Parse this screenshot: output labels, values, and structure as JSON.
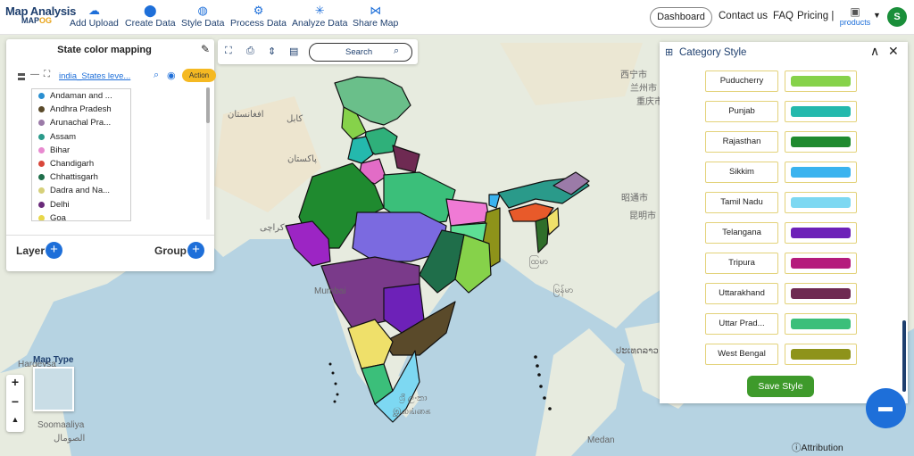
{
  "app": {
    "logo_line1": "Map Analysis",
    "logo_line2_a": "MAP",
    "logo_line2_b": "OG"
  },
  "nav": [
    {
      "label": "Add Upload",
      "icon": "cloud-upload-icon",
      "glyph": "☁"
    },
    {
      "label": "Create Data",
      "icon": "map-pin-icon",
      "glyph": "⬤"
    },
    {
      "label": "Style Data",
      "icon": "paint-bucket-icon",
      "glyph": "◍"
    },
    {
      "label": "Process Data",
      "icon": "process-icon",
      "glyph": "⚙"
    },
    {
      "label": "Analyze Data",
      "icon": "analyze-icon",
      "glyph": "✳"
    },
    {
      "label": "Share Map",
      "icon": "share-icon",
      "glyph": "⋈"
    }
  ],
  "header": {
    "dashboard": "Dashboard",
    "contact": "Contact us",
    "faq": "FAQ",
    "pricing": "Pricing |",
    "products": "products",
    "avatar": "S"
  },
  "layer_panel": {
    "title": "State color mapping",
    "layer_name": "india_States leve...",
    "action": "Action",
    "legend": [
      {
        "label": "Andaman and ...",
        "color": "#2a8fd1"
      },
      {
        "label": "Andhra Pradesh",
        "color": "#5a4a2a"
      },
      {
        "label": "Arunachal Pra...",
        "color": "#9b7ba8"
      },
      {
        "label": "Assam",
        "color": "#2a9a8a"
      },
      {
        "label": "Bihar",
        "color": "#e88ad0"
      },
      {
        "label": "Chandigarh",
        "color": "#d9473a"
      },
      {
        "label": "Chhattisgarh",
        "color": "#1f6e4a"
      },
      {
        "label": "Dadra and Na...",
        "color": "#d6d07a"
      },
      {
        "label": "Delhi",
        "color": "#6a2a7a"
      },
      {
        "label": "Goa",
        "color": "#e8d74a"
      }
    ],
    "layer_label": "Layer",
    "group_label": "Group"
  },
  "toolbar": {
    "search_placeholder": "Search"
  },
  "category_style": {
    "title": "Category Style",
    "rows": [
      {
        "name": "Puducherry",
        "color": "#86d24a"
      },
      {
        "name": "Punjab",
        "color": "#24b9ad"
      },
      {
        "name": "Rajasthan",
        "color": "#1f8a2f"
      },
      {
        "name": "Sikkim",
        "color": "#3ab3ef"
      },
      {
        "name": "Tamil Nadu",
        "color": "#7dd8f2"
      },
      {
        "name": "Telangana",
        "color": "#6d21b8"
      },
      {
        "name": "Tripura",
        "color": "#b51c7c"
      },
      {
        "name": "Uttarakhand",
        "color": "#6e2a52"
      },
      {
        "name": "Uttar Prad...",
        "color": "#3bbf7a"
      },
      {
        "name": "West Bengal",
        "color": "#8e931a"
      }
    ],
    "save": "Save Style"
  },
  "map": {
    "labels": [
      "افغانستان",
      "کابل",
      "پاکستان",
      "کراچی",
      "西宁市",
      "兰州市",
      "重庆市",
      "昭通市",
      "昆明市",
      "ထြမာ",
      "မြန်မာ",
      "ປະເທດລາວ",
      "ශ්‍රී ලංකා",
      "இலங்கை",
      "Hargeysa",
      "Soomaaliya",
      "الصومال",
      "Medan",
      "Mumbai"
    ],
    "map_type": "Map Type",
    "zoom_in": "+",
    "zoom_out": "−",
    "north": "▲",
    "attribution": "Attribution"
  }
}
